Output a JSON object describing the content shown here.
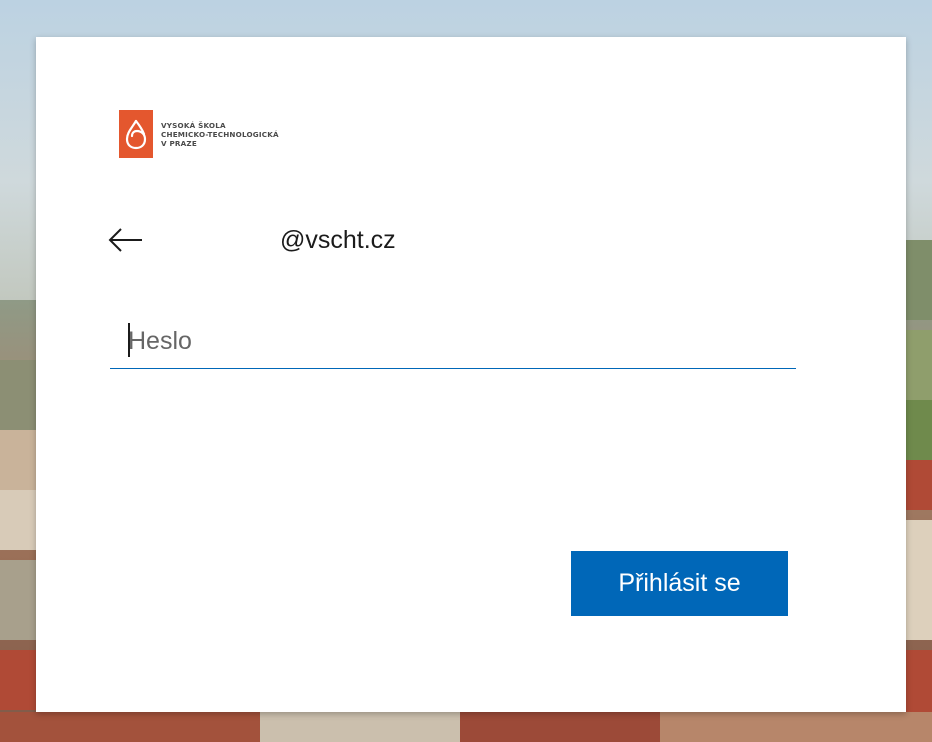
{
  "org": {
    "name_lines": [
      "VYSOKÁ ŠKOLA",
      "CHEMICKO-TECHNOLOGICKÁ",
      "V PRAZE"
    ],
    "brand_color": "#e4572e"
  },
  "identity": {
    "email": "@vscht.cz"
  },
  "password": {
    "placeholder": "Heslo",
    "value": ""
  },
  "signin_button": {
    "label": "Přihlásit se",
    "color": "#0067b8"
  },
  "icons": {
    "back": "arrow-left-icon",
    "logo": "drop-logo-icon"
  }
}
